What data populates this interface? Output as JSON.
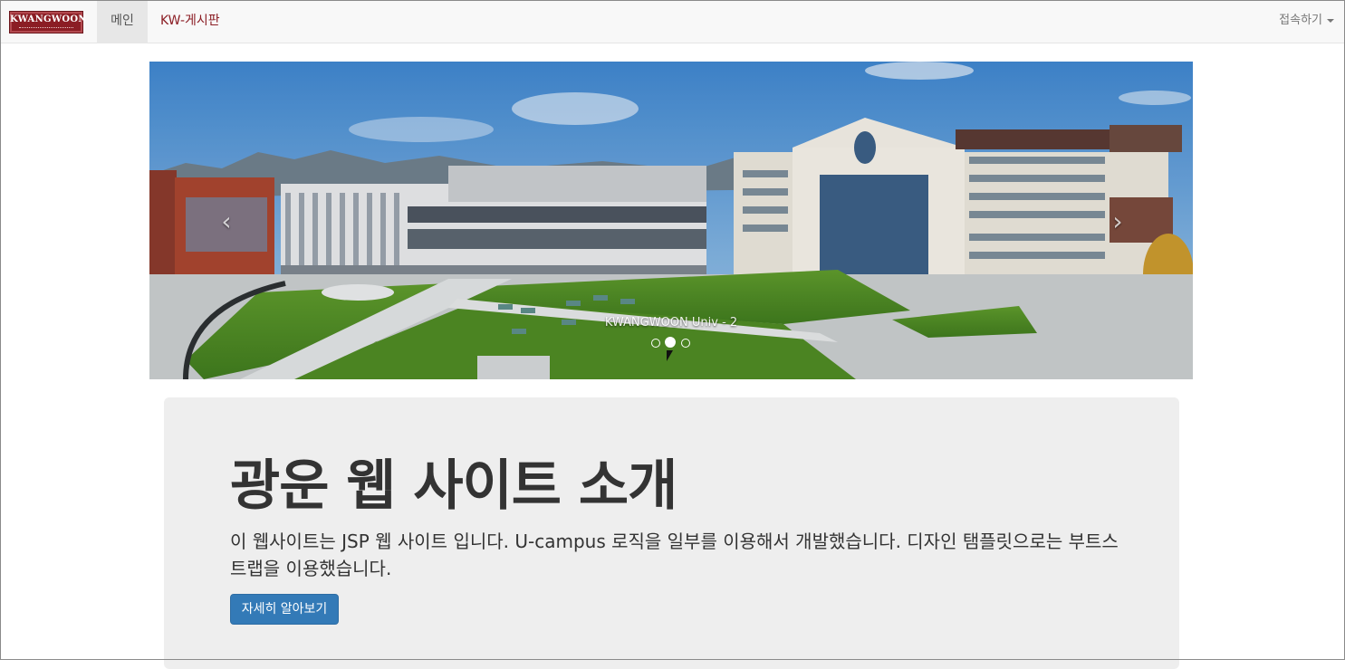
{
  "navbar": {
    "brand_text": "KWANGWOON",
    "brand_color": "#8b1d24",
    "items": [
      {
        "label": "메인",
        "active": true
      },
      {
        "label": "KW-게시판",
        "active": false
      }
    ],
    "connect_label": "접속하기"
  },
  "carousel": {
    "caption": "KWANGWOON Univ - 2",
    "prev_icon": "chevron-left-icon",
    "next_icon": "chevron-right-icon",
    "indicator_count": 3,
    "active_index": 1
  },
  "jumbotron": {
    "title": "광운 웹 사이트 소개",
    "description": "이 웹사이트는 JSP 웹 사이트 입니다. U-campus 로직을 일부를 이용해서 개발했습니다. 디자인 탬플릿으로는 부트스트랩을 이용했습니다.",
    "button_label": "자세히 알아보기",
    "button_color": "#337ab7"
  }
}
